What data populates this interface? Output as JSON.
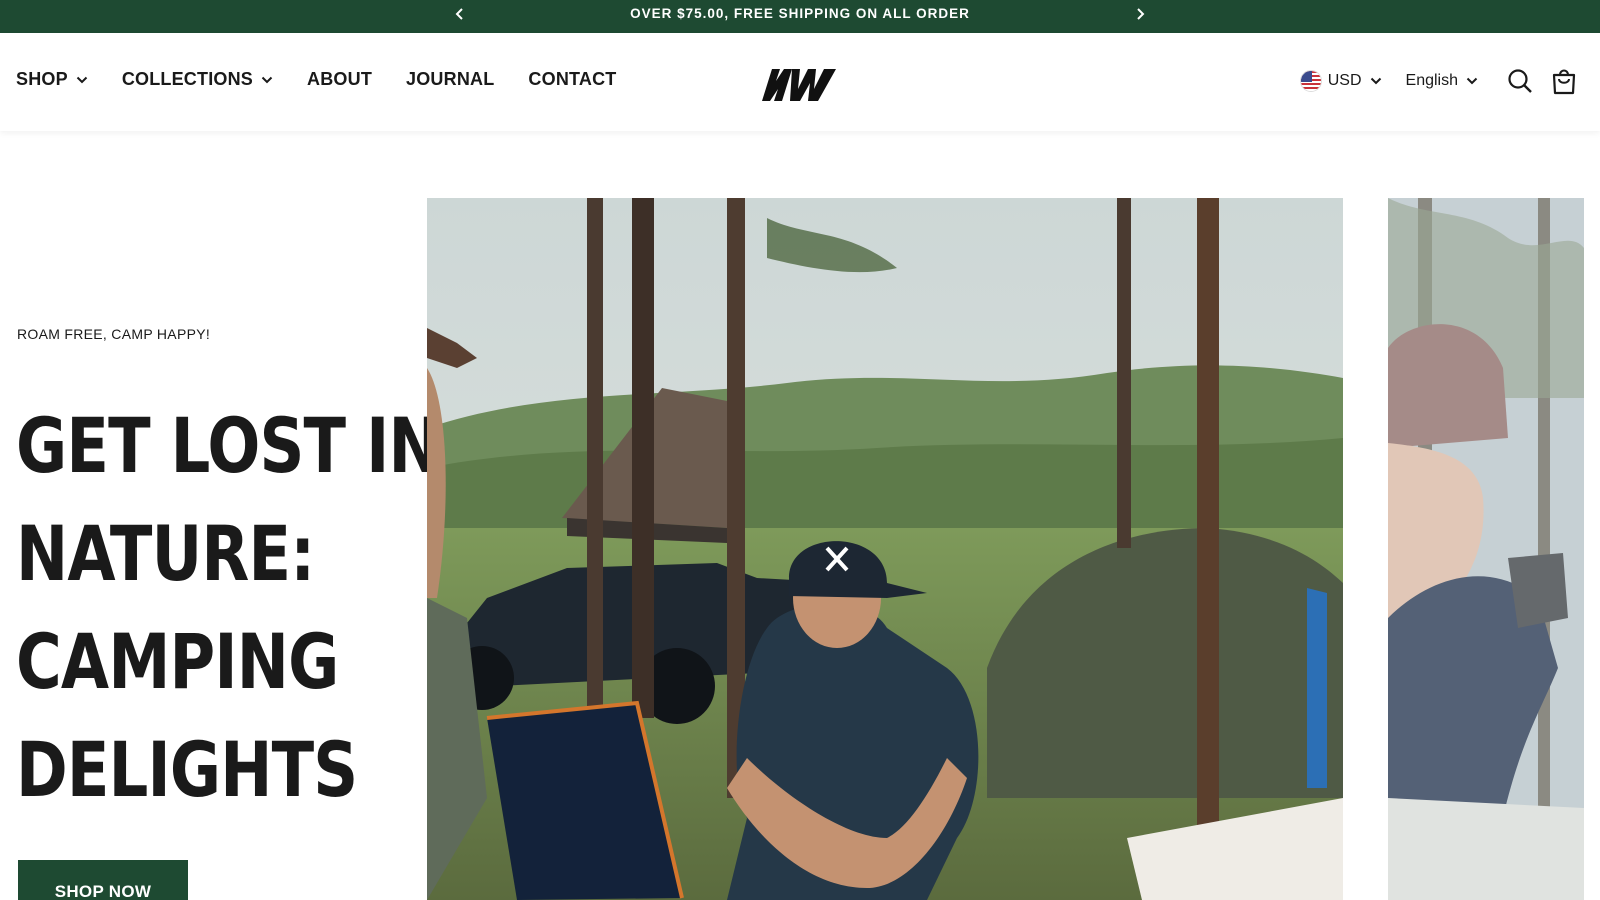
{
  "announcement": {
    "text": "OVER $75.00, FREE SHIPPING ON ALL ORDER",
    "prev_icon": "chevron-left-icon",
    "next_icon": "chevron-right-icon"
  },
  "nav": {
    "items": [
      {
        "label": "SHOP",
        "has_dropdown": true
      },
      {
        "label": "COLLECTIONS",
        "has_dropdown": true
      },
      {
        "label": "ABOUT",
        "has_dropdown": false
      },
      {
        "label": "JOURNAL",
        "has_dropdown": false
      },
      {
        "label": "CONTACT",
        "has_dropdown": false
      }
    ]
  },
  "logo": {
    "icon": "brand-logo"
  },
  "utility": {
    "currency": "USD",
    "language": "English",
    "search_icon": "search-icon",
    "cart_icon": "cart-icon"
  },
  "hero": {
    "eyebrow": "ROAM FREE, CAMP HAPPY!",
    "headline_lines": [
      "GET LOST IN",
      "NATURE:",
      "CAMPING",
      "DELIGHTS"
    ],
    "button_label": "SHOP NOW"
  },
  "colors": {
    "brand_green": "#1e4a32",
    "text": "#1a1a1a"
  }
}
